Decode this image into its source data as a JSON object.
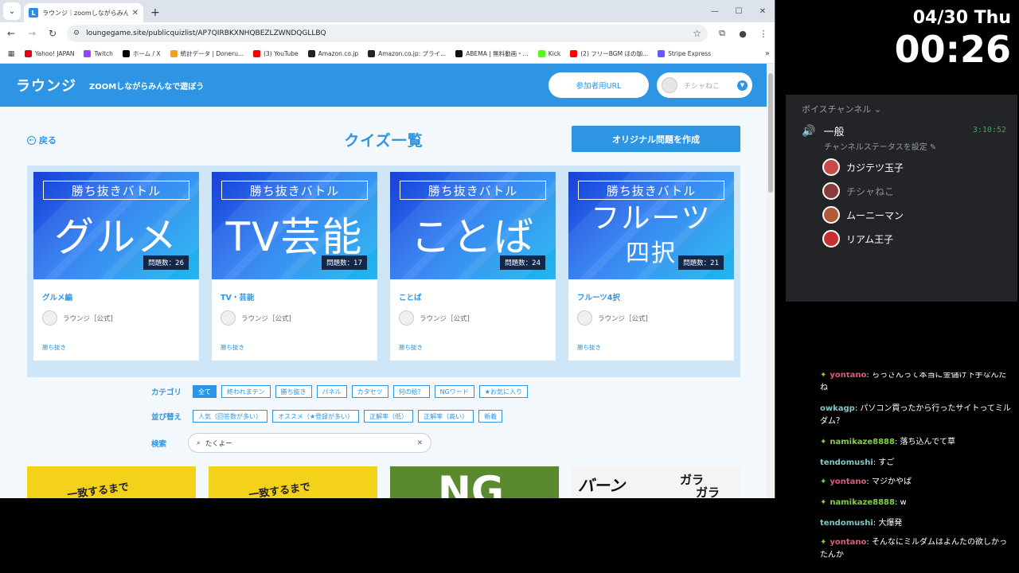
{
  "browser": {
    "tab_title": "ラウンジ｜zoomしながらみんなで遊",
    "url": "loungegame.site/publicquizlist/AP7QIRBKXNHQBEZLZWNDQGLLBQ",
    "bookmarks": [
      {
        "label": "Yahoo! JAPAN",
        "color": "#e60012"
      },
      {
        "label": "Twitch",
        "color": "#9146ff"
      },
      {
        "label": "ホーム / X",
        "color": "#000000"
      },
      {
        "label": "統計データ | Doneru...",
        "color": "#f0a020"
      },
      {
        "label": "(3) YouTube",
        "color": "#ff0000"
      },
      {
        "label": "Amazon.co.jp",
        "color": "#222222"
      },
      {
        "label": "Amazon.co.jp: プライ...",
        "color": "#222222"
      },
      {
        "label": "ABEMA | 無料動画・...",
        "color": "#111111"
      },
      {
        "label": "Kick",
        "color": "#53fc18"
      },
      {
        "label": "(2) フリーBGM ほの珈...",
        "color": "#ff0000"
      },
      {
        "label": "Stripe Express",
        "color": "#635bff"
      }
    ]
  },
  "site": {
    "logo": "ラウンジ",
    "tagline": "ZOOMしながらみんなで遊ぼう",
    "join_url_button": "参加者用URL",
    "user_name": "チシャねこ",
    "back": "戻る",
    "title": "クイズ一覧",
    "create_button": "オリジナル問題を作成"
  },
  "cards": [
    {
      "banner": "勝ち抜きバトル",
      "big": "グルメ",
      "count": "問題数：26",
      "title": "グルメ編",
      "author": "ラウンジ［公式]",
      "tag": "勝ち抜き"
    },
    {
      "banner": "勝ち抜きバトル",
      "big": "TV芸能",
      "count": "問題数：17",
      "title": "TV・芸能",
      "author": "ラウンジ［公式]",
      "tag": "勝ち抜き"
    },
    {
      "banner": "勝ち抜きバトル",
      "big": "ことば",
      "count": "問題数：24",
      "title": "ことば",
      "author": "ラウンジ［公式]",
      "tag": "勝ち抜き"
    },
    {
      "banner": "勝ち抜きバトル",
      "big": "フルーツ",
      "big2": "四択",
      "count": "問題数：21",
      "title": "フルーツ4択",
      "author": "ラウンジ［公式]",
      "tag": "勝ち抜き"
    }
  ],
  "filters": {
    "category_label": "カテゴリ",
    "categories": [
      "全て",
      "終われまテン",
      "勝ち抜き",
      "パネル",
      "カタセツ",
      "何の絵？",
      "NGワード",
      "★お気に入り"
    ],
    "sort_label": "並び替え",
    "sorts": [
      "人気（回答数が多い）",
      "オススメ（★登録が多い）",
      "正解率（低）",
      "正解率（高い）",
      "新着"
    ],
    "search_label": "検索",
    "search_value": "たくよー"
  },
  "overlay": {
    "date": "04/30 Thu",
    "time": "00:26",
    "voice_header": "ボイスチャンネル",
    "channel": "一般",
    "timer": "3:10:52",
    "status": "チャンネルステータスを設定",
    "members": [
      "カジテツ玉子",
      "チシャねこ",
      "ムーニーマン",
      "リアム王子"
    ]
  },
  "chat": [
    {
      "user": "yontano",
      "text": "ちっさんって本当に金儲け下手なんだね",
      "spark": true,
      "color": "#e05a7a"
    },
    {
      "user": "owkagp",
      "text": "パソコン買ったから行ったサイトってミルダム？",
      "spark": false,
      "color": "#7ec8c8"
    },
    {
      "user": "namikaze8888",
      "text": "落ち込んでて草",
      "spark": true,
      "color": "#7fd13b"
    },
    {
      "user": "tendomushi",
      "text": "すご",
      "spark": false,
      "color": "#7ec8c8"
    },
    {
      "user": "yontano",
      "text": "マジかやば",
      "spark": true,
      "color": "#e05a7a"
    },
    {
      "user": "namikaze8888",
      "text": "w",
      "spark": true,
      "color": "#7fd13b"
    },
    {
      "user": "tendomushi",
      "text": "大爆発",
      "spark": false,
      "color": "#7ec8c8"
    },
    {
      "user": "yontano",
      "text": "そんなにミルダムはよんたの欲しかったんか",
      "spark": true,
      "color": "#e05a7a"
    }
  ]
}
